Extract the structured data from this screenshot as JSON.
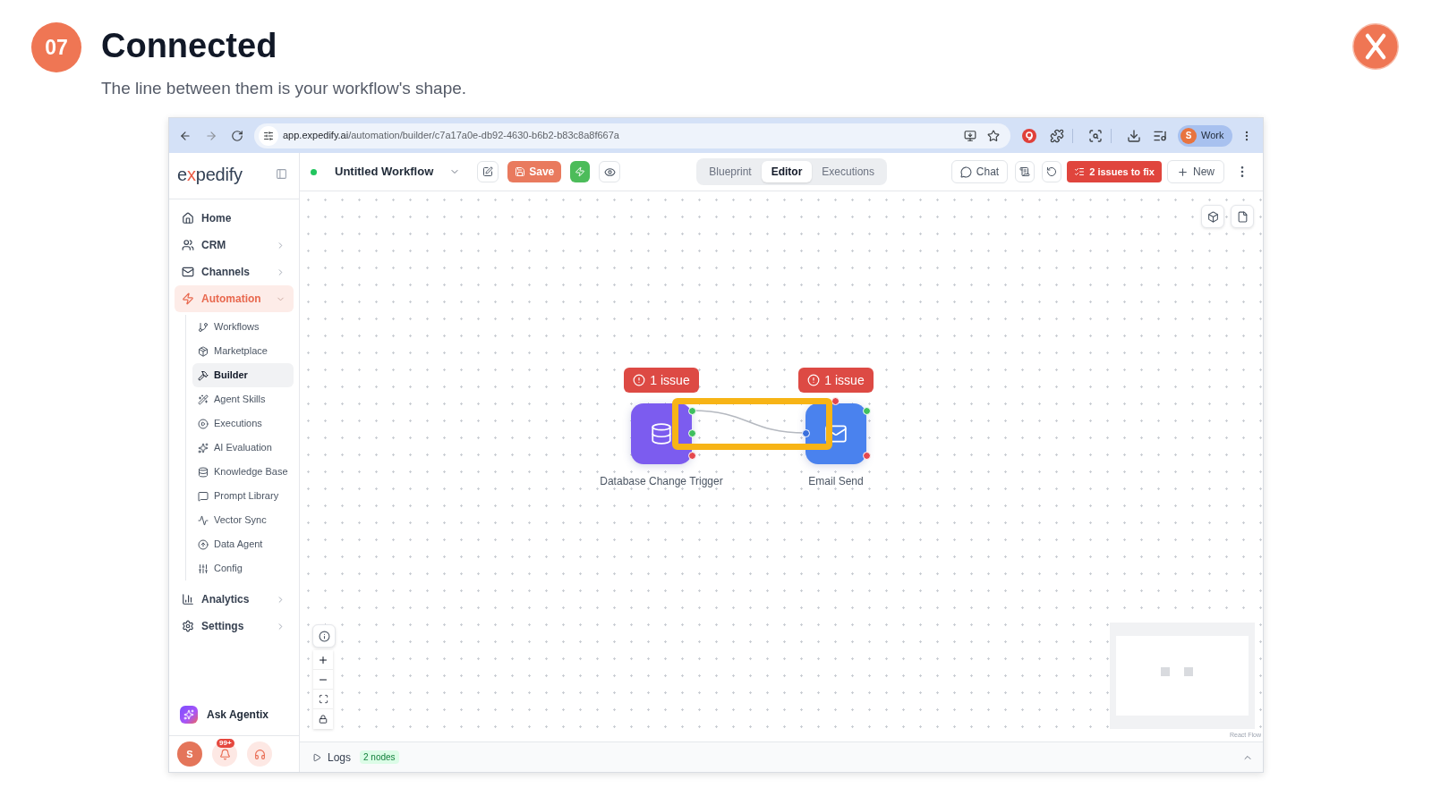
{
  "slide": {
    "step": "07",
    "title": "Connected",
    "subtitle": "The line between them is your workflow's shape."
  },
  "browser": {
    "can_go_forward": false,
    "url_host": "app.expedify.ai",
    "url_path": "/automation/builder/c7a17a0e-db92-4630-b6b2-b83c8a8f667a",
    "profile_initial": "S",
    "profile_label": "Work"
  },
  "sidebar": {
    "logo": [
      {
        "text": "e",
        "accent": false
      },
      {
        "text": "x",
        "accent": true
      },
      {
        "text": "pedify",
        "accent": false
      }
    ],
    "items": [
      {
        "kind": "link",
        "label": "Home",
        "selected": false
      },
      {
        "kind": "group",
        "label": "CRM",
        "selected": false,
        "expanded": false
      },
      {
        "kind": "group",
        "label": "Channels",
        "selected": false,
        "expanded": false
      },
      {
        "kind": "group",
        "label": "Automation",
        "selected": true,
        "expanded": true,
        "children": [
          {
            "label": "Workflows",
            "selected": false
          },
          {
            "label": "Marketplace",
            "selected": false
          },
          {
            "label": "Builder",
            "selected": true
          },
          {
            "label": "Agent Skills",
            "selected": false
          },
          {
            "label": "Executions",
            "selected": false
          },
          {
            "label": "AI Evaluation",
            "selected": false
          },
          {
            "label": "Knowledge Base",
            "selected": false
          },
          {
            "label": "Prompt Library",
            "selected": false
          },
          {
            "label": "Vector Sync",
            "selected": false
          },
          {
            "label": "Data Agent",
            "selected": false
          },
          {
            "label": "Config",
            "selected": false
          }
        ]
      },
      {
        "kind": "group",
        "label": "Analytics",
        "selected": false,
        "expanded": false
      },
      {
        "kind": "group",
        "label": "Settings",
        "selected": false,
        "expanded": false
      }
    ],
    "assistant_label": "Ask Agentix",
    "user_initial": "S",
    "notification_count": "99+"
  },
  "toolbar": {
    "workflow_title": "Untitled Workflow",
    "save_label": "Save",
    "tabs": [
      {
        "label": "Blueprint",
        "selected": false
      },
      {
        "label": "Editor",
        "selected": true
      },
      {
        "label": "Executions",
        "selected": false
      }
    ],
    "chat_label": "Chat",
    "issues_label": "2 issues to fix",
    "new_label": "New"
  },
  "canvas": {
    "nodes": [
      {
        "kind": "trigger",
        "label": "Database Change Trigger",
        "issue": "1 issue",
        "color": "#7c5cef"
      },
      {
        "kind": "action",
        "label": "Email Send",
        "issue": "1 issue",
        "color": "#4a82ee"
      }
    ],
    "attribution": "React Flow"
  },
  "logs": {
    "label": "Logs",
    "badge": "2 nodes"
  }
}
